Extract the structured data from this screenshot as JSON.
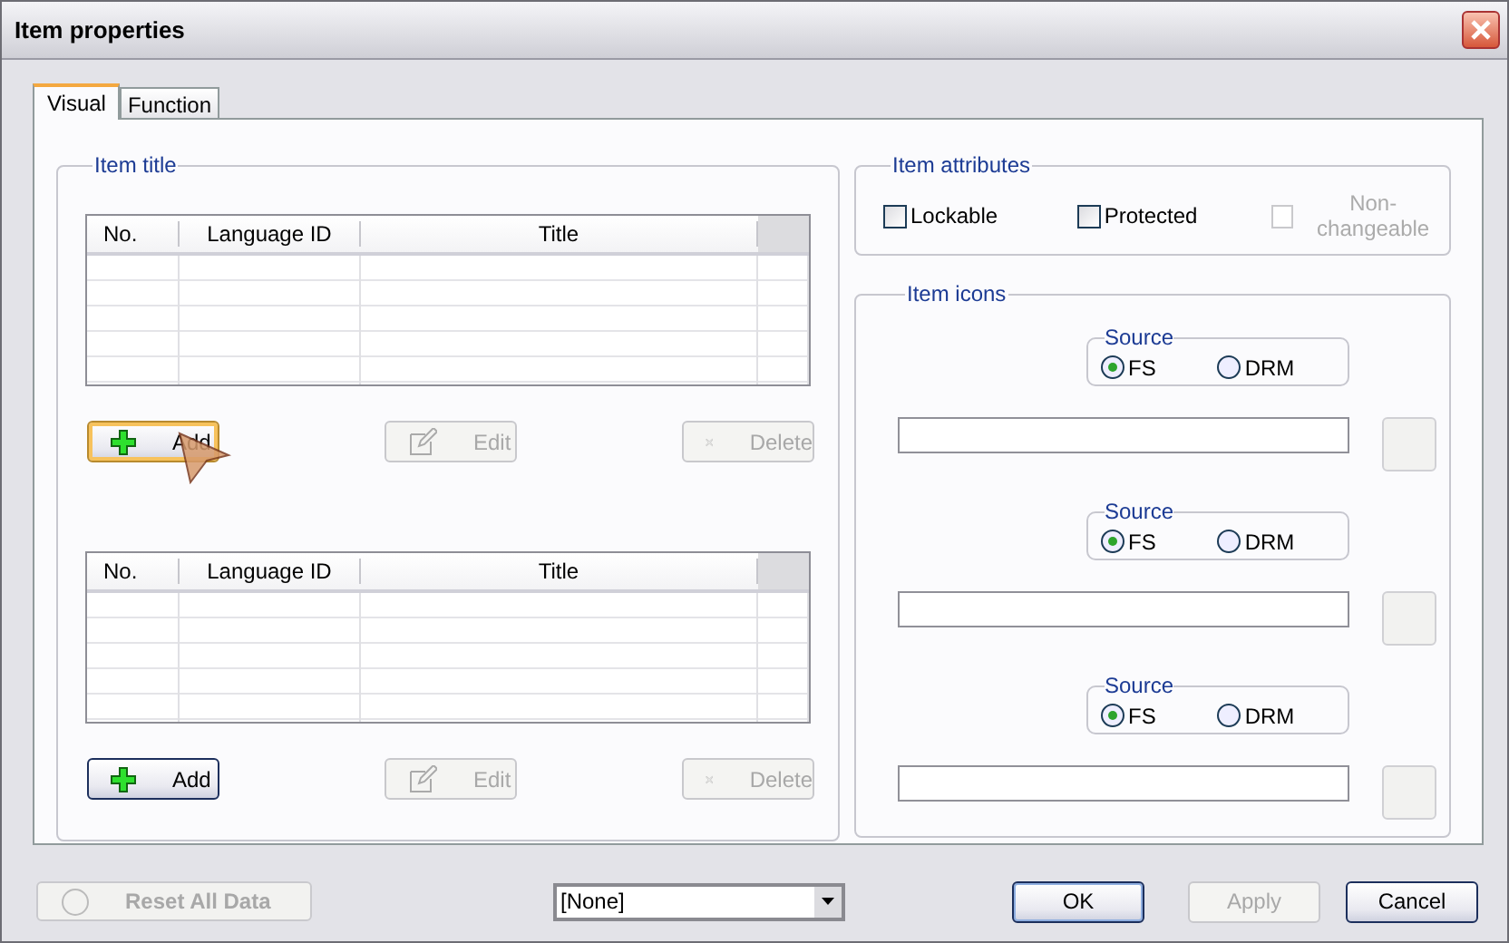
{
  "window": {
    "title": "Item properties"
  },
  "tabs": [
    {
      "label": "Visual",
      "selected": true
    },
    {
      "label": "Function",
      "selected": false
    }
  ],
  "item_title": {
    "label": "Item title",
    "lists": [
      {
        "columns": [
          "No.",
          "Language ID",
          "Title"
        ],
        "buttons": [
          {
            "kind": "add",
            "label": "Add",
            "disabled": false,
            "hovered": true
          },
          {
            "kind": "edit",
            "label": "Edit",
            "disabled": true,
            "hovered": false
          },
          {
            "kind": "delete",
            "label": "Delete",
            "disabled": true,
            "hovered": false
          }
        ]
      },
      {
        "columns": [
          "No.",
          "Language ID",
          "Title"
        ],
        "buttons": [
          {
            "kind": "add",
            "label": "Add",
            "disabled": false,
            "hovered": false
          },
          {
            "kind": "edit",
            "label": "Edit",
            "disabled": true,
            "hovered": false
          },
          {
            "kind": "delete",
            "label": "Delete",
            "disabled": true,
            "hovered": false
          }
        ]
      }
    ]
  },
  "item_attributes": {
    "label": "Item attributes",
    "checkboxes": [
      {
        "label": "Lockable",
        "checked": false,
        "disabled": false
      },
      {
        "label": "Protected",
        "checked": false,
        "disabled": false
      },
      {
        "label": "Non-changeable",
        "checked": false,
        "disabled": true
      }
    ]
  },
  "item_icons": {
    "label": "Item icons",
    "slots": [
      {
        "source_label": "Source",
        "options": [
          {
            "label": "FS",
            "selected": true
          },
          {
            "label": "DRM",
            "selected": false
          }
        ]
      },
      {
        "source_label": "Source",
        "options": [
          {
            "label": "FS",
            "selected": true
          },
          {
            "label": "DRM",
            "selected": false
          }
        ]
      },
      {
        "source_label": "Source",
        "options": [
          {
            "label": "FS",
            "selected": true
          },
          {
            "label": "DRM",
            "selected": false
          }
        ]
      }
    ]
  },
  "footer": {
    "reset": {
      "label": "Reset All Data",
      "disabled": true
    },
    "combo": {
      "value": "[None]"
    },
    "buttons": [
      {
        "label": "OK",
        "disabled": false,
        "default": true
      },
      {
        "label": "Apply",
        "disabled": true,
        "default": false
      },
      {
        "label": "Cancel",
        "disabled": false,
        "default": false
      }
    ]
  }
}
